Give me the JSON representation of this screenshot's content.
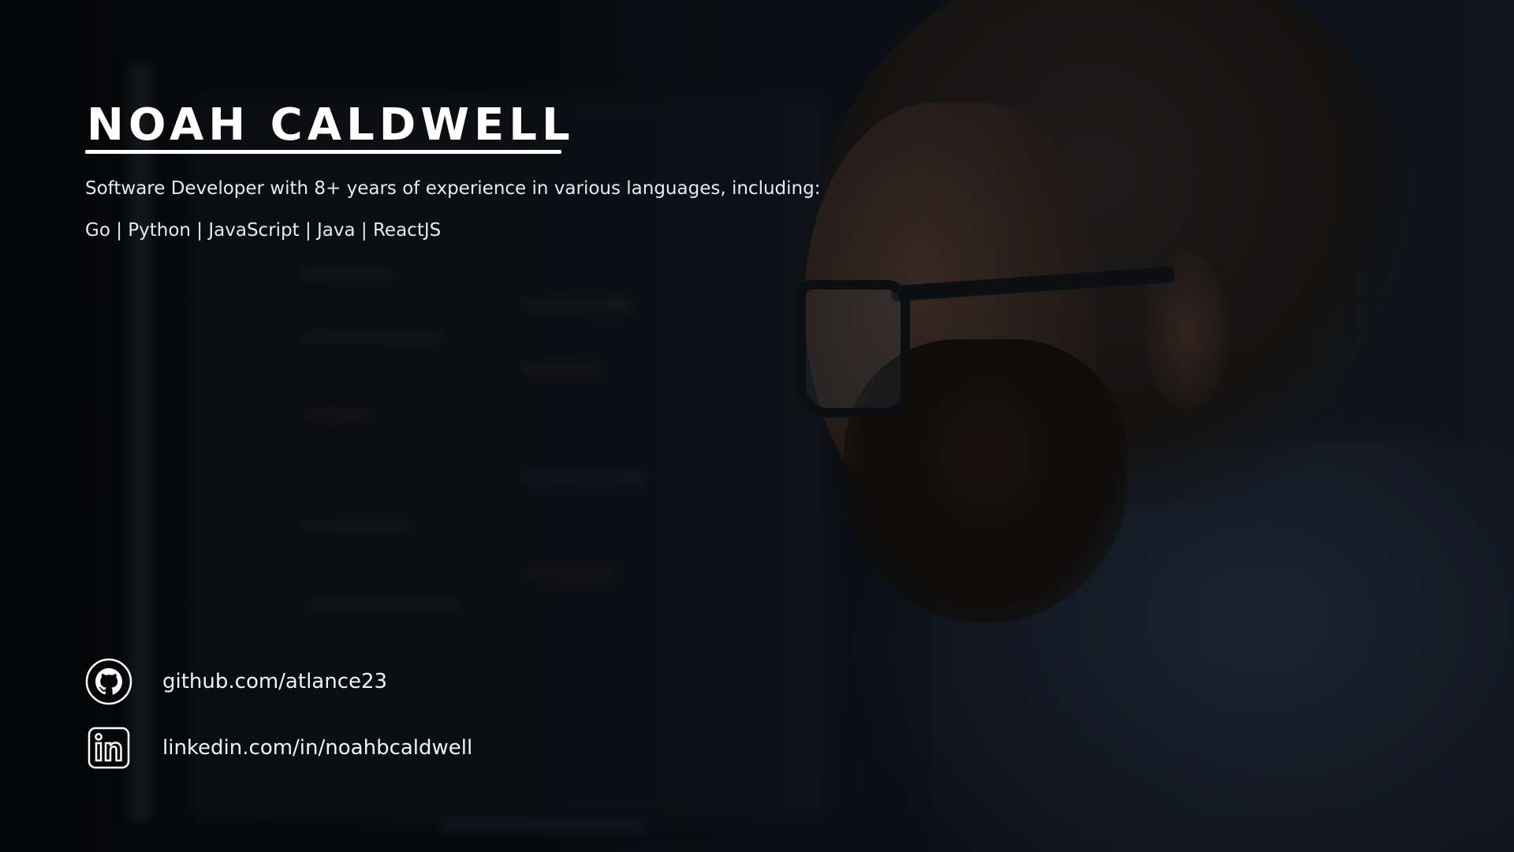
{
  "profile": {
    "name": "NOAH CALDWELL",
    "summary": "Software Developer with 8+ years of experience in various languages, including:",
    "skills": "Go | Python | JavaScript | Java | ReactJS"
  },
  "contacts": {
    "github": {
      "icon": "github-icon",
      "label": "github.com/atlance23"
    },
    "linkedin": {
      "icon": "linkedin-icon",
      "label": "linkedin.com/in/noahbcaldwell"
    }
  },
  "colors": {
    "text": "#ffffff",
    "background": "#07090c"
  }
}
